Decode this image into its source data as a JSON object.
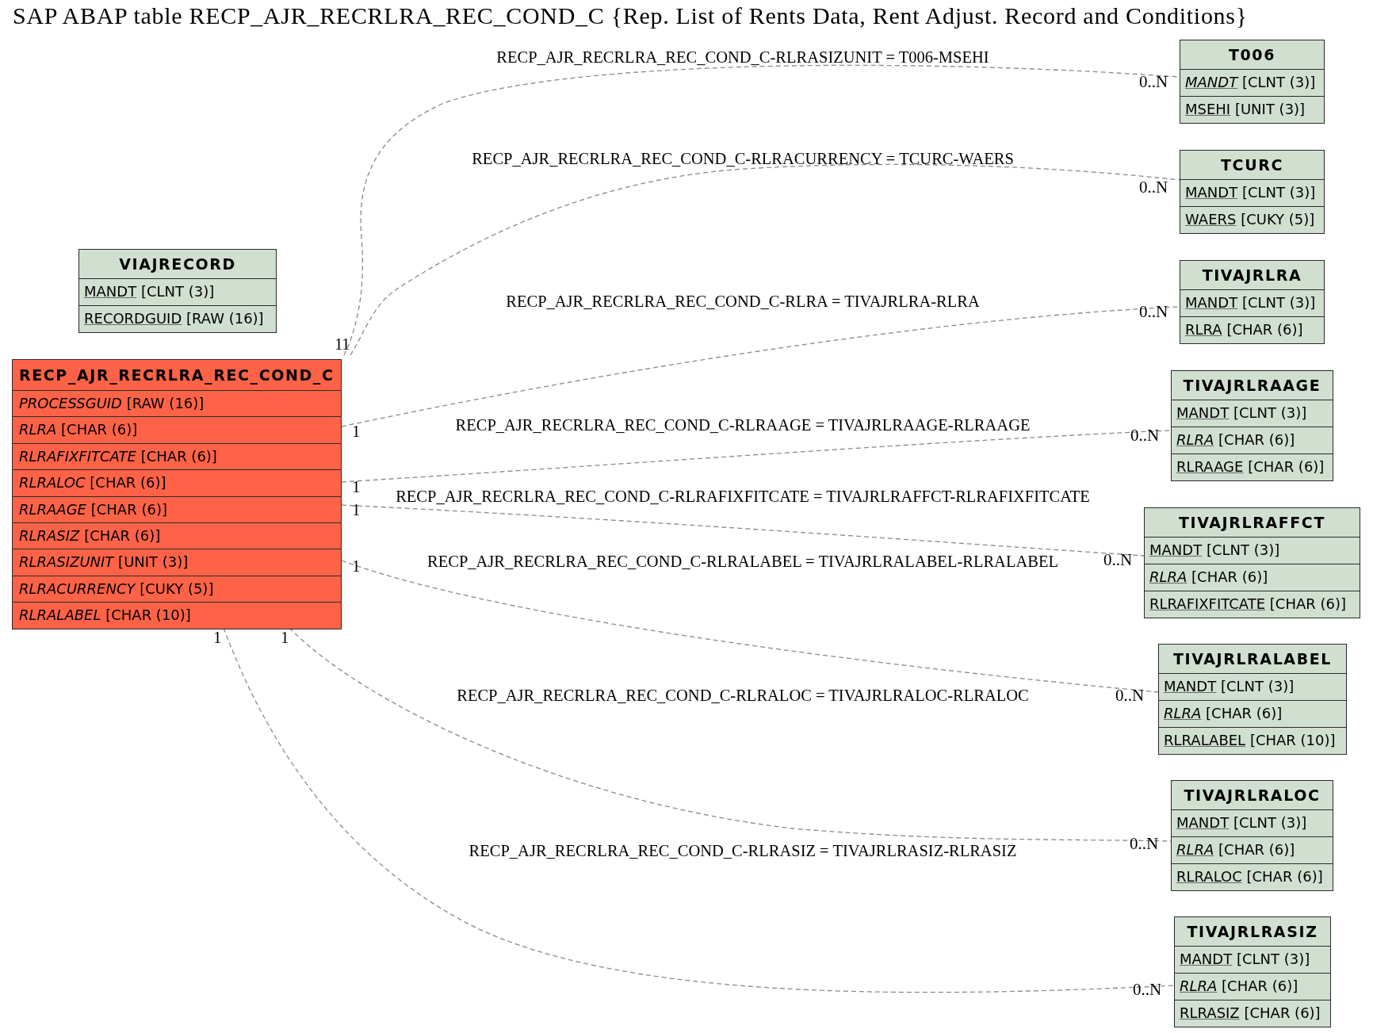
{
  "title": "SAP ABAP table RECP_AJR_RECRLRA_REC_COND_C {Rep. List of Rents Data, Rent Adjust. Record and Conditions}",
  "tables": [
    {
      "name": "VIAJRECORD",
      "kind": "related",
      "fields": [
        {
          "name": "MANDT",
          "type": "[CLNT (3)]",
          "key": true,
          "foreign_key": false
        },
        {
          "name": "RECORDGUID",
          "type": "[RAW (16)]",
          "key": true,
          "foreign_key": false
        }
      ]
    },
    {
      "name": "RECP_AJR_RECRLRA_REC_COND_C",
      "kind": "main",
      "fields": [
        {
          "name": "PROCESSGUID",
          "type": "[RAW (16)]",
          "key": false,
          "foreign_key": true
        },
        {
          "name": "RLRA",
          "type": "[CHAR (6)]",
          "key": false,
          "foreign_key": true
        },
        {
          "name": "RLRAFIXFITCATE",
          "type": "[CHAR (6)]",
          "key": false,
          "foreign_key": true
        },
        {
          "name": "RLRALOC",
          "type": "[CHAR (6)]",
          "key": false,
          "foreign_key": true
        },
        {
          "name": "RLRAAGE",
          "type": "[CHAR (6)]",
          "key": false,
          "foreign_key": true
        },
        {
          "name": "RLRASIZ",
          "type": "[CHAR (6)]",
          "key": false,
          "foreign_key": true
        },
        {
          "name": "RLRASIZUNIT",
          "type": "[UNIT (3)]",
          "key": false,
          "foreign_key": true
        },
        {
          "name": "RLRACURRENCY",
          "type": "[CUKY (5)]",
          "key": false,
          "foreign_key": true
        },
        {
          "name": "RLRALABEL",
          "type": "[CHAR (10)]",
          "key": false,
          "foreign_key": true
        }
      ]
    },
    {
      "name": "T006",
      "kind": "related",
      "fields": [
        {
          "name": "MANDT",
          "type": "[CLNT (3)]",
          "key": true,
          "foreign_key": true
        },
        {
          "name": "MSEHI",
          "type": "[UNIT (3)]",
          "key": true,
          "foreign_key": false
        }
      ]
    },
    {
      "name": "TCURC",
      "kind": "related",
      "fields": [
        {
          "name": "MANDT",
          "type": "[CLNT (3)]",
          "key": true,
          "foreign_key": false
        },
        {
          "name": "WAERS",
          "type": "[CUKY (5)]",
          "key": true,
          "foreign_key": false
        }
      ]
    },
    {
      "name": "TIVAJRLRA",
      "kind": "related",
      "fields": [
        {
          "name": "MANDT",
          "type": "[CLNT (3)]",
          "key": true,
          "foreign_key": false
        },
        {
          "name": "RLRA",
          "type": "[CHAR (6)]",
          "key": true,
          "foreign_key": false
        }
      ]
    },
    {
      "name": "TIVAJRLRAAGE",
      "kind": "related",
      "fields": [
        {
          "name": "MANDT",
          "type": "[CLNT (3)]",
          "key": true,
          "foreign_key": false
        },
        {
          "name": "RLRA",
          "type": "[CHAR (6)]",
          "key": true,
          "foreign_key": true
        },
        {
          "name": "RLRAAGE",
          "type": "[CHAR (6)]",
          "key": true,
          "foreign_key": false
        }
      ]
    },
    {
      "name": "TIVAJRLRAFFCT",
      "kind": "related",
      "fields": [
        {
          "name": "MANDT",
          "type": "[CLNT (3)]",
          "key": true,
          "foreign_key": false
        },
        {
          "name": "RLRA",
          "type": "[CHAR (6)]",
          "key": true,
          "foreign_key": true
        },
        {
          "name": "RLRAFIXFITCATE",
          "type": "[CHAR (6)]",
          "key": true,
          "foreign_key": false
        }
      ]
    },
    {
      "name": "TIVAJRLRALABEL",
      "kind": "related",
      "fields": [
        {
          "name": "MANDT",
          "type": "[CLNT (3)]",
          "key": true,
          "foreign_key": false
        },
        {
          "name": "RLRA",
          "type": "[CHAR (6)]",
          "key": true,
          "foreign_key": true
        },
        {
          "name": "RLRALABEL",
          "type": "[CHAR (10)]",
          "key": true,
          "foreign_key": false
        }
      ]
    },
    {
      "name": "TIVAJRLRALOC",
      "kind": "related",
      "fields": [
        {
          "name": "MANDT",
          "type": "[CLNT (3)]",
          "key": true,
          "foreign_key": false
        },
        {
          "name": "RLRA",
          "type": "[CHAR (6)]",
          "key": true,
          "foreign_key": true
        },
        {
          "name": "RLRALOC",
          "type": "[CHAR (6)]",
          "key": true,
          "foreign_key": false
        }
      ]
    },
    {
      "name": "TIVAJRLRASIZ",
      "kind": "related",
      "fields": [
        {
          "name": "MANDT",
          "type": "[CLNT (3)]",
          "key": true,
          "foreign_key": false
        },
        {
          "name": "RLRA",
          "type": "[CHAR (6)]",
          "key": true,
          "foreign_key": true
        },
        {
          "name": "RLRASIZ",
          "type": "[CHAR (6)]",
          "key": true,
          "foreign_key": false
        }
      ]
    }
  ],
  "relations": [
    {
      "label": "RECP_AJR_RECRLRA_REC_COND_C-RLRASIZUNIT = T006-MSEHI",
      "source_cardinality": "1",
      "target_cardinality": "0..N"
    },
    {
      "label": "RECP_AJR_RECRLRA_REC_COND_C-RLRACURRENCY = TCURC-WAERS",
      "source_cardinality": "1",
      "target_cardinality": "0..N"
    },
    {
      "label": "RECP_AJR_RECRLRA_REC_COND_C-RLRA = TIVAJRLRA-RLRA",
      "source_cardinality": "1",
      "target_cardinality": "0..N"
    },
    {
      "label": "RECP_AJR_RECRLRA_REC_COND_C-RLRAAGE = TIVAJRLRAAGE-RLRAAGE",
      "source_cardinality": "1",
      "target_cardinality": "0..N"
    },
    {
      "label": "RECP_AJR_RECRLRA_REC_COND_C-RLRAFIXFITCATE = TIVAJRLRAFFCT-RLRAFIXFITCATE",
      "source_cardinality": "1",
      "target_cardinality": "0..N"
    },
    {
      "label": "RECP_AJR_RECRLRA_REC_COND_C-RLRALABEL = TIVAJRLRALABEL-RLRALABEL",
      "source_cardinality": "1",
      "target_cardinality": "0..N"
    },
    {
      "label": "RECP_AJR_RECRLRA_REC_COND_C-RLRALOC = TIVAJRLRALOC-RLRALOC",
      "source_cardinality": "1",
      "target_cardinality": "0..N"
    },
    {
      "label": "RECP_AJR_RECRLRA_REC_COND_C-RLRASIZ = TIVAJRLRASIZ-RLRASIZ",
      "source_cardinality": "1",
      "target_cardinality": "0..N"
    }
  ]
}
